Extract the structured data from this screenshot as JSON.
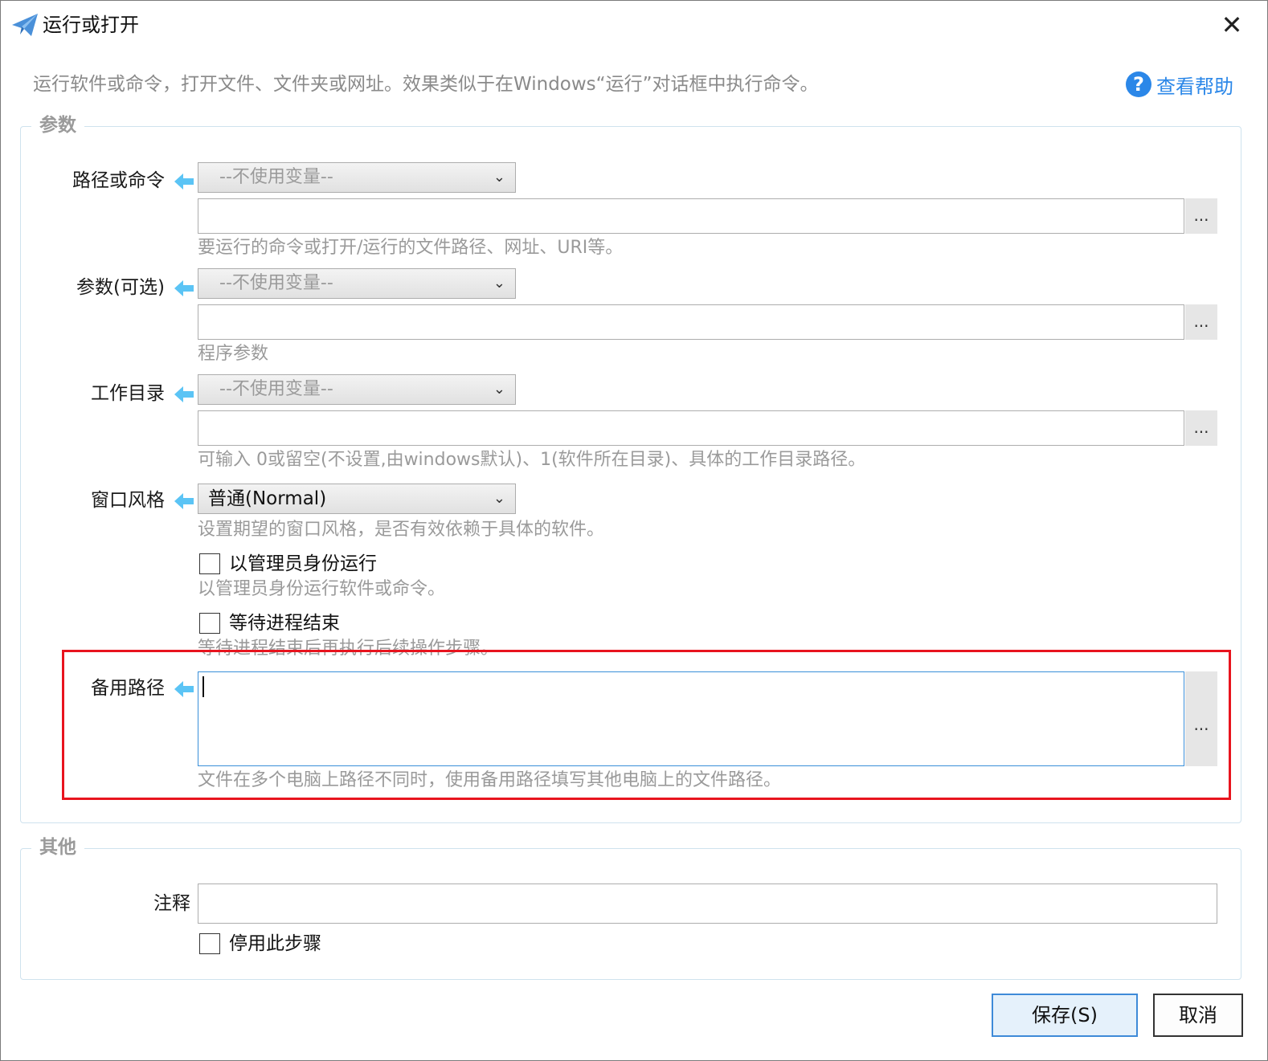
{
  "window": {
    "title": "运行或打开",
    "close_icon": "close-icon"
  },
  "description": "运行软件或命令，打开文件、文件夹或网址。效果类似于在Windows“运行”对话框中执行命令。",
  "help": {
    "label": "查看帮助",
    "icon": "question-circle-icon",
    "color": "#2b87e8"
  },
  "params": {
    "legend": "参数",
    "path": {
      "label": "路径或命令",
      "variable": "--不使用变量--",
      "value": "",
      "browse": "...",
      "hint": "要运行的命令或打开/运行的文件路径、网址、URI等。"
    },
    "args": {
      "label": "参数(可选)",
      "variable": "--不使用变量--",
      "value": "",
      "browse": "...",
      "hint": "程序参数"
    },
    "workdir": {
      "label": "工作目录",
      "variable": "--不使用变量--",
      "value": "",
      "browse": "...",
      "hint": "可输入 0或留空(不设置,由windows默认)、1(软件所在目录)、具体的工作目录路径。"
    },
    "window_style": {
      "label": "窗口风格",
      "selected": "普通(Normal)",
      "hint": "设置期望的窗口风格，是否有效依赖于具体的软件。"
    },
    "run_as_admin": {
      "label": "以管理员身份运行",
      "checked": false,
      "hint": "以管理员身份运行软件或命令。"
    },
    "wait_exit": {
      "label": "等待进程结束",
      "checked": false,
      "hint": "等待进程结束后再执行后续操作步骤。"
    },
    "backup_path": {
      "label": "备用路径",
      "value": "",
      "browse": "...",
      "hint": "文件在多个电脑上路径不同时，使用备用路径填写其他电脑上的文件路径。"
    }
  },
  "other": {
    "legend": "其他",
    "comment": {
      "label": "注释",
      "value": ""
    },
    "disable_step": {
      "label": "停用此步骤",
      "checked": false
    }
  },
  "buttons": {
    "save": "保存(S)",
    "cancel": "取消"
  },
  "colors": {
    "accent": "#3e8ad8",
    "highlight_box": "#e8141e",
    "hint_text": "#9a9a9a",
    "arrow": "#5bc4f5"
  }
}
